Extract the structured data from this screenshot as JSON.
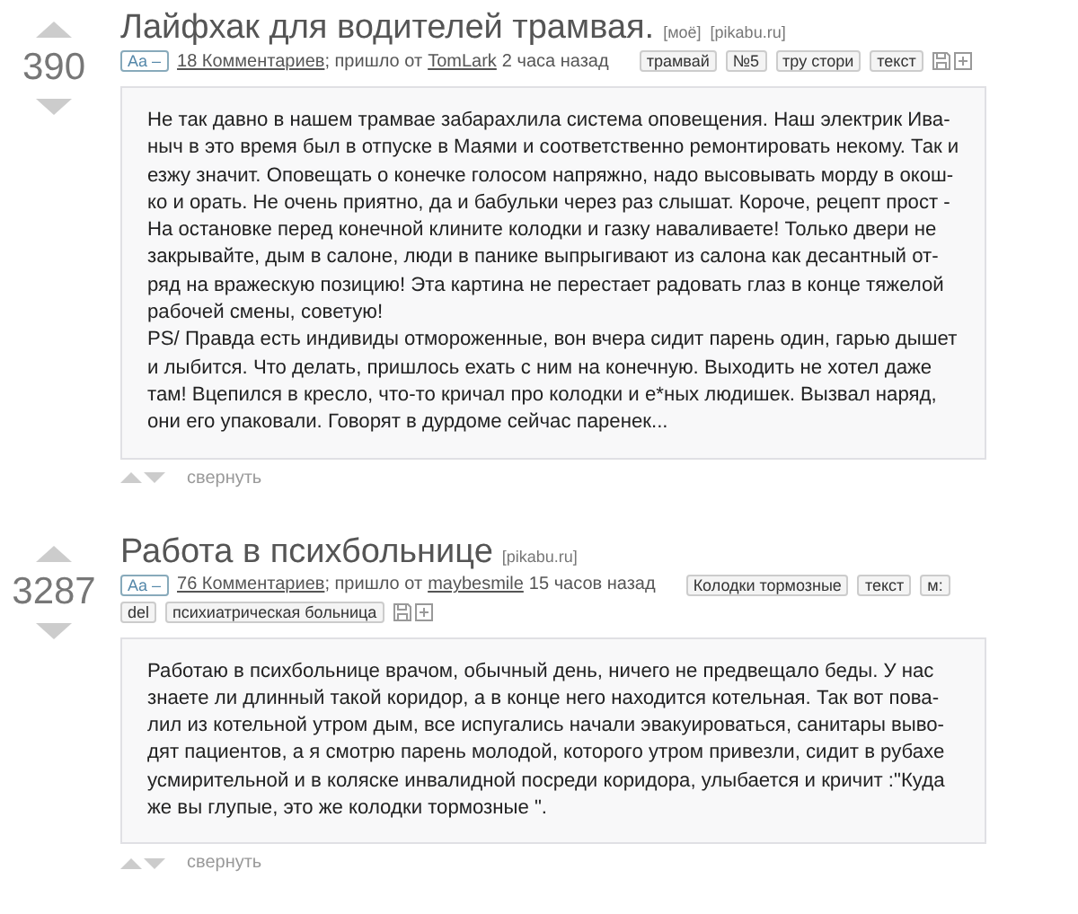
{
  "posts": [
    {
      "rating": "390",
      "title": "Лайфхак для водителей трамвая.",
      "title_tags": [
        "[моё]",
        "[pikabu.ru]"
      ],
      "meta": {
        "font_button": "Aa –",
        "comments": "18 Комментариев",
        "via": "; пришло от",
        "author": "TomLark",
        "time": "2 часа назад"
      },
      "tags": [
        "трамвай",
        "№5",
        "тру стори",
        "текст"
      ],
      "body": [
        [
          "Не так давно в нашем трамвае забарахлила система оповещения. Наш электрик Ива-",
          "ныч в это время был в отпуске в Маями и соответственно ремонтировать некому. Так и",
          "езжу значит. Оповещать о конечке голосом напряжно, надо высовывать морду в окош-",
          "ко и орать. Не очень приятно, да и бабульки через раз слышат. Короче, рецепт прост -",
          "На остановке перед конечной клините колодки и газку наваливаете! Только двери не",
          "закрывайте, дым в салоне, люди в панике выпрыгивают из салона как десантный от-",
          "ряд на вражескую позицию! Эта картина не перестает радовать глаз в конце тяжелой",
          "рабочей смены, советую!"
        ],
        [
          "PS/ Правда есть индивиды отмороженные, вон вчера сидит парень один, гарью дышет",
          "и лыбится. Что делать, пришлось ехать с ним на конечную. Выходить не хотел даже",
          "там! Вцепился в кресло, что-то кричал про колодки и е*ных людишек. Вызвал наряд,",
          "они его упаковали. Говорят в дурдоме сейчас паренек..."
        ]
      ],
      "collapse": "свернуть"
    },
    {
      "rating": "3287",
      "title": "Работа в психбольнице",
      "title_tags": [
        "[pikabu.ru]"
      ],
      "meta": {
        "font_button": "Aa –",
        "comments": "76 Комментариев",
        "via": "; пришло от",
        "author": "maybesmile",
        "time": "15 часов назад"
      },
      "tags": [
        "Колодки тормозные",
        "текст",
        "м:",
        "del",
        "психиатрическая больница"
      ],
      "body": [
        [
          "Работаю в психбольнице врачом, обычный день, ничего не предвещало беды. У нас",
          "знаете ли длинный такой коридор, а в конце него находится котельная. Так вот пова-",
          "лил из котельной утром дым, все испугались начали эвакуироваться, санитары выво-",
          "дят пациентов, а я смотрю парень молодой, которого утром привезли, сидит в рубахе",
          "усмирительной и в коляске инвалидной посреди коридора, улыбается и кричит :\"Куда",
          "же вы глупые, это же колодки тормозные \"."
        ]
      ],
      "collapse": "свернуть"
    }
  ]
}
